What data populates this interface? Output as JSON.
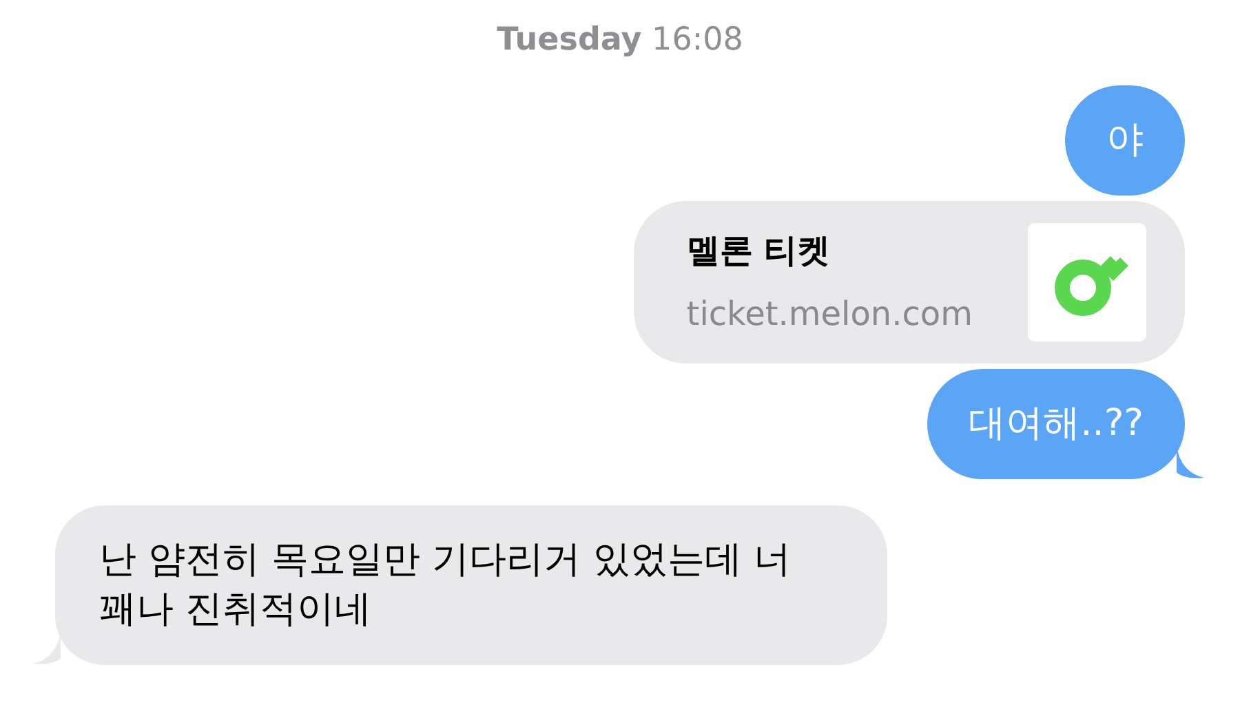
{
  "timestamp": {
    "day": "Tuesday",
    "time": "16:08"
  },
  "messages": [
    {
      "kind": "text",
      "from_me": true,
      "tail": false,
      "text": "야"
    },
    {
      "kind": "link",
      "from_me": true,
      "tail": false,
      "title": "멜론 티켓",
      "domain": "ticket.melon.com"
    },
    {
      "kind": "text",
      "from_me": true,
      "tail": true,
      "text": "대여해..??"
    },
    {
      "kind": "text",
      "from_me": false,
      "tail": true,
      "text": "난 얌전히 목요일만 기다리거 있었는데 너 꽤나 진취적이네"
    }
  ]
}
